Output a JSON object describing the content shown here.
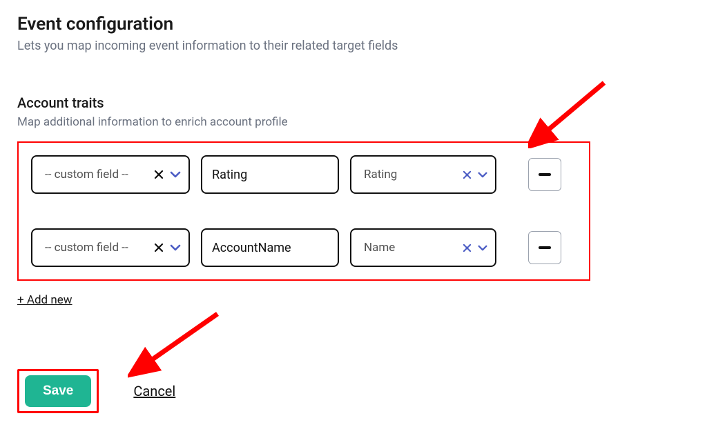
{
  "header": {
    "title": "Event configuration",
    "subtitle": "Lets you map incoming event information to their related target fields"
  },
  "section": {
    "title": "Account traits",
    "subtitle": "Map additional information to enrich account profile"
  },
  "rows": [
    {
      "select1": "-- custom field --",
      "text": "Rating",
      "select2": "Rating"
    },
    {
      "select1": "-- custom field --",
      "text": "AccountName",
      "select2": "Name"
    }
  ],
  "addNew": "+ Add new",
  "actions": {
    "save": "Save",
    "cancel": "Cancel"
  }
}
